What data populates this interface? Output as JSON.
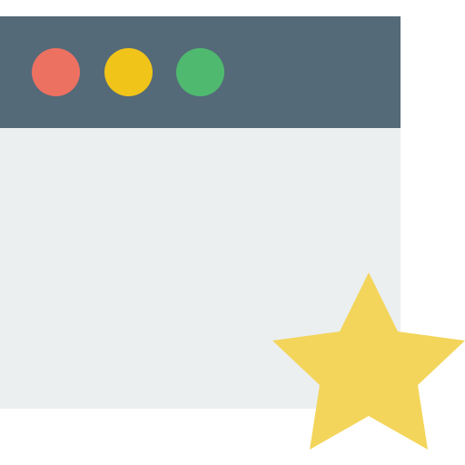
{
  "icon_name": "browser-window-favorite-icon",
  "colors": {
    "titlebar": "#546A79",
    "content": "#EBEFF0",
    "close": "#ED7161",
    "minimize": "#F0C419",
    "maximize": "#4FBA6F",
    "star": "#F3D55B"
  },
  "window": {
    "controls": [
      {
        "name": "close",
        "icon": "close-dot"
      },
      {
        "name": "minimize",
        "icon": "minimize-dot"
      },
      {
        "name": "maximize",
        "icon": "maximize-dot"
      }
    ]
  },
  "badge": {
    "icon": "star-icon"
  }
}
